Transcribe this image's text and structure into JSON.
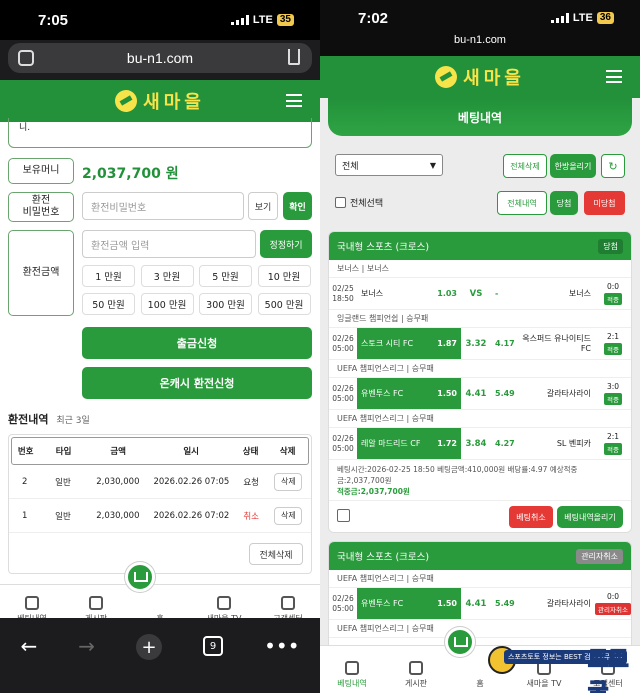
{
  "left": {
    "status": {
      "time": "7:05",
      "network": "LTE",
      "battery": "35"
    },
    "url": "bu-n1.com",
    "logo": "새마을",
    "top_text": "니.",
    "balance": {
      "label": "보유머니",
      "value": "2,037,700 원"
    },
    "password": {
      "label": "환전\n비밀번호",
      "placeholder": "환전비밀번호",
      "show": "보기",
      "confirm": "확인"
    },
    "amount": {
      "label": "환전금액",
      "placeholder": "환전금액 입력",
      "reset": "정정하기",
      "options": [
        "1 만원",
        "3 만원",
        "5 만원",
        "10 만원",
        "50 만원",
        "100 만원",
        "300 만원",
        "500 만원"
      ]
    },
    "withdraw_button": "출금신청",
    "oncash_button": "온캐시 환전신청",
    "history": {
      "title": "환전내역",
      "subtitle": "최근 3일",
      "headers": [
        "번호",
        "타입",
        "금액",
        "일시",
        "상태",
        "삭제"
      ],
      "rows": [
        {
          "no": "2",
          "type": "일반",
          "amount": "2,030,000",
          "date": "2026.02.26 07:05",
          "status": "요청",
          "del": "삭제"
        },
        {
          "no": "1",
          "type": "일반",
          "amount": "2,030,000",
          "date": "2026.02.26 07:02",
          "status": "취소",
          "del": "삭제"
        }
      ],
      "delete_all": "전체삭제"
    },
    "nav": [
      "베팅내역",
      "게시판",
      "홈",
      "새마을 TV",
      "고객센터"
    ],
    "tabs_count": "9"
  },
  "right": {
    "status": {
      "time": "7:02",
      "network": "LTE",
      "battery": "36"
    },
    "url": "bu-n1.com",
    "logo": "새마을",
    "page_title": "베팅내역",
    "filter": "전체",
    "buttons": {
      "delete_all": "전체삭제",
      "fold_all": "한방올리기",
      "select_all": "전체선택",
      "all_history": "전체내역",
      "win": "당첨",
      "unwin": "미당첨"
    },
    "card1": {
      "title": "국내형 스포츠 (크로스)",
      "badge": "당첨",
      "groups": [
        {
          "league": "보너스 | 보너스",
          "date": "02/25",
          "time": "18:50",
          "home": "보너스",
          "home_odds": "1.03",
          "draw": "VS",
          "away_odds": "-",
          "away": "보너스",
          "score": "0:0",
          "result": "적중"
        },
        {
          "league": "잉글랜드 챔피언쉽 | 승무패",
          "date": "02/26",
          "time": "05:00",
          "home": "스토크 시티 FC",
          "home_odds": "1.87",
          "draw": "3.32",
          "away_odds": "4.17",
          "away": "옥스퍼드 유나이티드 FC",
          "score": "2:1",
          "result": "적중"
        },
        {
          "league": "UEFA 챔피언스리그 | 승무패",
          "date": "02/26",
          "time": "05:00",
          "home": "유벤투스 FC",
          "home_odds": "1.50",
          "draw": "4.41",
          "away_odds": "5.49",
          "away": "갈라타사라이",
          "score": "3:0",
          "result": "적중"
        },
        {
          "league": "UEFA 챔피언스리그 | 승무패",
          "date": "02/26",
          "time": "05:00",
          "home": "레알 마드리드 CF",
          "home_odds": "1.72",
          "draw": "3.84",
          "away_odds": "4.27",
          "away": "SL 벤피카",
          "score": "2:1",
          "result": "적중"
        }
      ],
      "summary_line": "베팅시간:2026-02-25 18:50   베팅금액:410,000원   배당률:4.97   예상적중금:2,037,700원",
      "payout": "적중금:2,037,700원",
      "cancel": "베팅취소",
      "post": "베팅내역올리기"
    },
    "card2": {
      "title": "국내형 스포츠 (크로스)",
      "badge": "관리자취소",
      "groups": [
        {
          "league": "UEFA 챔피언스리그 | 승무패",
          "date": "02/26",
          "time": "05:00",
          "home": "유벤투스 FC",
          "home_odds": "1.50",
          "draw": "4.41",
          "away_odds": "5.49",
          "away": "갈라타사라이",
          "score": "0:0",
          "result": "관리자취소"
        },
        {
          "league": "UEFA 챔피언스리그 | 승무패"
        }
      ]
    },
    "nav": [
      "베팅내역",
      "게시판",
      "홈",
      "새마을 TV",
      "고객센터"
    ],
    "watermark": "토토굴",
    "watermark_sub": "스포츠토토 정보는 BEST 검증커뮤니티"
  }
}
